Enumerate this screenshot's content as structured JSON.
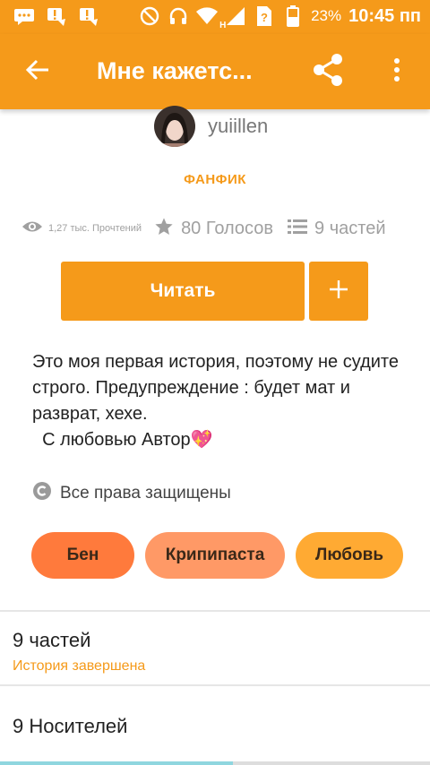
{
  "status_bar": {
    "time": "10:45 пп",
    "battery_percent": "23%",
    "network_letter": "H",
    "left_icons": [
      "message-icon",
      "alert-icon",
      "alert-icon"
    ],
    "right_icons": [
      "no-disturb-icon",
      "headset-icon",
      "wifi-icon",
      "signal-icon",
      "sim-question-icon",
      "battery-icon"
    ]
  },
  "app_bar": {
    "title": "Мне кажетс...",
    "icons": [
      "back-arrow-icon",
      "share-icon",
      "more-vertical-icon"
    ],
    "color": "#f59a1a"
  },
  "author": {
    "name": "yuiillen"
  },
  "category": "ФАНФИК",
  "stats": {
    "reads": "1,27 тыс. Прочтений",
    "votes": "80 Голосов",
    "parts": "9 частей"
  },
  "actions": {
    "read_label": "Читать",
    "add_label": "+"
  },
  "description": "Это моя первая история, поэтому не судите строго. Предупреждение : будет мат и разврат, хехе.\n  С любовью Автор💖",
  "copyright": "Все права защищены",
  "tags": [
    {
      "label": "Бен",
      "color": "#ff7a3c"
    },
    {
      "label": "Крипипаста",
      "color": "#ff9966"
    },
    {
      "label": "Любовь",
      "color": "#ffaa33"
    }
  ],
  "parts_section": {
    "title": "9 частей",
    "status": "История завершена"
  },
  "media_section": {
    "title": "9 Носителей"
  }
}
